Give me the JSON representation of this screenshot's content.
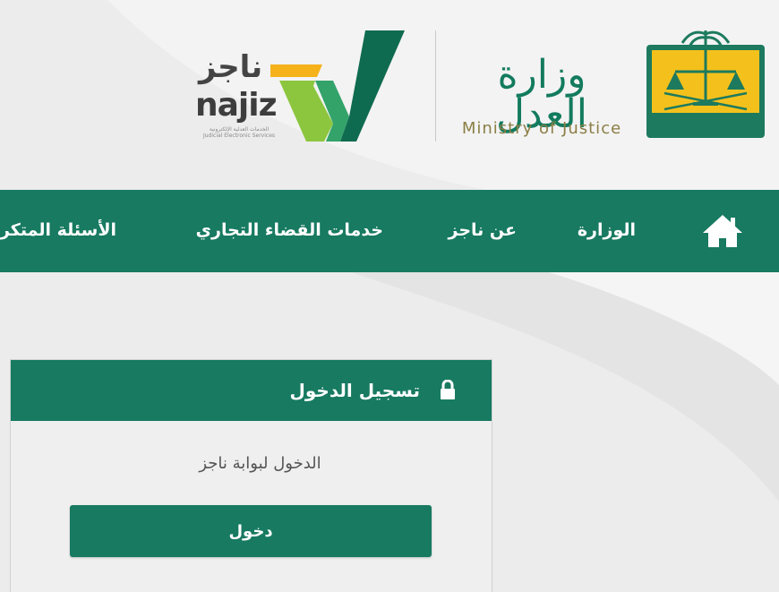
{
  "colors": {
    "primary_green": "#177a61",
    "moj_green": "#137b5e",
    "moj_gold": "#8b7e45",
    "najiz_lime": "#8cc63f",
    "najiz_yellow": "#f6b21b",
    "najiz_dark_green": "#0f6b50",
    "background": "#ececec"
  },
  "header": {
    "najiz_logo": {
      "arabic": "ناجز",
      "latin": "najiz",
      "tagline_ar": "الخدمات العدلية الإلكترونية",
      "tagline_en": "Judicial Electronic Services"
    },
    "moj_logo": {
      "arabic": "وزارة العدل",
      "english": "Ministry of Justice",
      "emblem_text": "وزارة العدل"
    }
  },
  "nav": {
    "home_icon": "home-icon",
    "items": [
      {
        "label": "الوزارة"
      },
      {
        "label": "عن ناجز"
      },
      {
        "label": "خدمات القضاء التجاري"
      },
      {
        "label": "الأسئلة المتكررة"
      }
    ]
  },
  "login_card": {
    "title": "تسجيل الدخول",
    "icon": "lock-icon",
    "description": "الدخول لبوابة ناجز",
    "button_label": "دخول"
  }
}
